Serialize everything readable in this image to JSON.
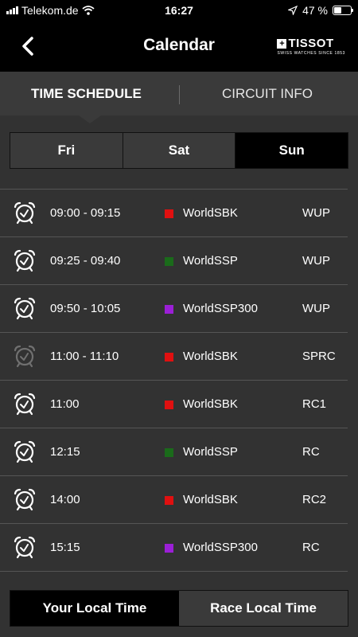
{
  "status_bar": {
    "carrier": "Telekom.de",
    "time": "16:27",
    "battery": "47 %",
    "battery_level": 0.47
  },
  "header": {
    "title": "Calendar",
    "brand_name": "TISSOT",
    "brand_tagline": "SWISS WATCHES SINCE 1853",
    "brand_cross": "+"
  },
  "tabs": [
    {
      "label": "TIME SCHEDULE",
      "active": true
    },
    {
      "label": "CIRCUIT INFO",
      "active": false
    }
  ],
  "days": [
    {
      "label": "Fri",
      "selected": false
    },
    {
      "label": "Sat",
      "selected": false
    },
    {
      "label": "Sun",
      "selected": true
    }
  ],
  "schedule": [
    {
      "time": "09:00 - 09:15",
      "series": "WorldSBK",
      "session": "WUP",
      "color": "#e01010",
      "past": false
    },
    {
      "time": "09:25 - 09:40",
      "series": "WorldSSP",
      "session": "WUP",
      "color": "#1a6b1a",
      "past": false
    },
    {
      "time": "09:50 - 10:05",
      "series": "WorldSSP300",
      "session": "WUP",
      "color": "#9b1fd6",
      "past": false
    },
    {
      "time": "11:00 - 11:10",
      "series": "WorldSBK",
      "session": "SPRC",
      "color": "#e01010",
      "past": true
    },
    {
      "time": "11:00",
      "series": "WorldSBK",
      "session": "RC1",
      "color": "#e01010",
      "past": false
    },
    {
      "time": "12:15",
      "series": "WorldSSP",
      "session": "RC",
      "color": "#1a6b1a",
      "past": false
    },
    {
      "time": "14:00",
      "series": "WorldSBK",
      "session": "RC2",
      "color": "#e01010",
      "past": false
    },
    {
      "time": "15:15",
      "series": "WorldSSP300",
      "session": "RC",
      "color": "#9b1fd6",
      "past": false
    }
  ],
  "time_toggle": [
    {
      "label": "Your Local Time",
      "selected": true
    },
    {
      "label": "Race Local Time",
      "selected": false
    }
  ]
}
